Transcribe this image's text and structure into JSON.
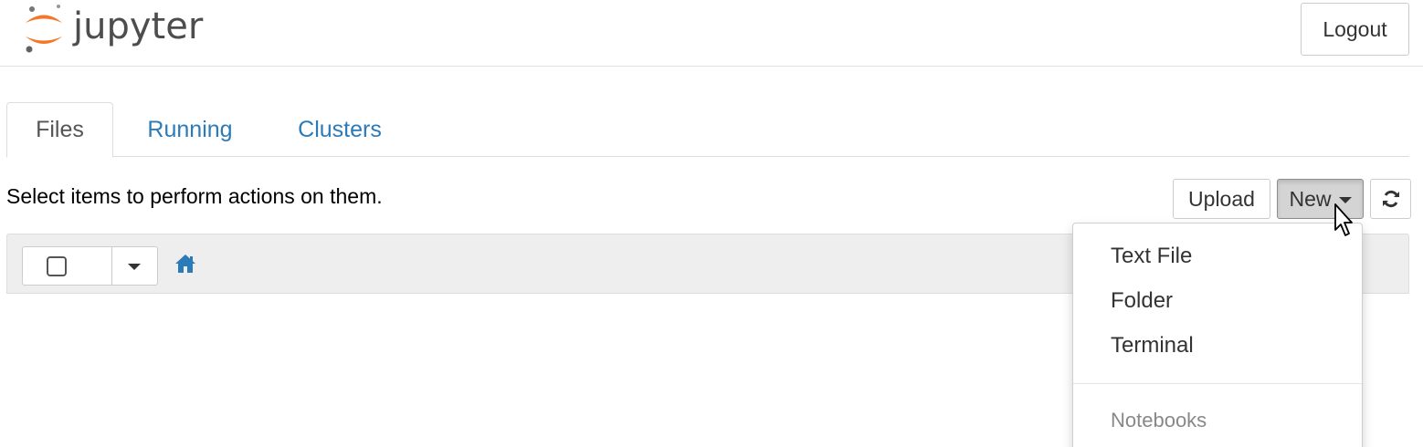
{
  "header": {
    "logo_text": "jupyter",
    "logout_label": "Logout"
  },
  "tabs": [
    {
      "label": "Files",
      "active": true
    },
    {
      "label": "Running",
      "active": false
    },
    {
      "label": "Clusters",
      "active": false
    }
  ],
  "toolbar": {
    "instructions": "Select items to perform actions on them.",
    "upload_label": "Upload",
    "new_label": "New",
    "refresh_icon": "refresh-icon"
  },
  "file_list": {
    "home_icon": "home-icon",
    "select_all_checked": false
  },
  "new_menu": {
    "items": [
      {
        "label": "Text File"
      },
      {
        "label": "Folder"
      },
      {
        "label": "Terminal"
      }
    ],
    "section_header": "Notebooks"
  },
  "colors": {
    "link": "#2b7bb9",
    "jupyter_orange": "#f37726",
    "logo_gray": "#4d4d4d"
  }
}
